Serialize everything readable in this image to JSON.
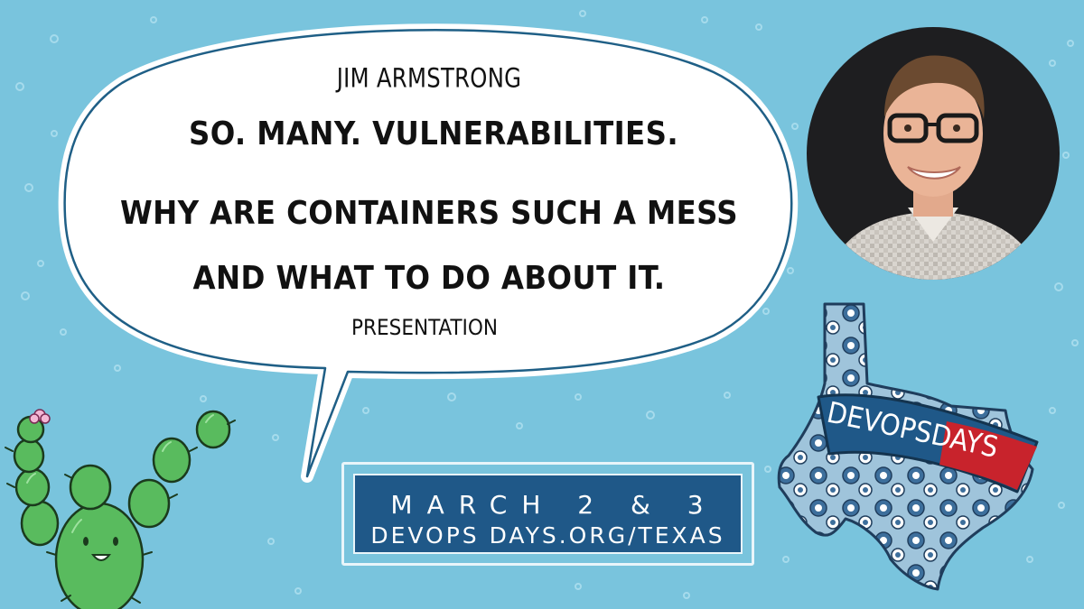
{
  "speaker": "JIM ARMSTRONG",
  "title_line1": "SO. MANY. VULNERABILITIES.",
  "title_line2": "WHY ARE CONTAINERS SUCH A MESS AND WHAT TO DO ABOUT IT.",
  "presentation_type": "PRESENTATION",
  "event": {
    "dates": "MARCH 2 & 3",
    "url": "DEVOPS DAYS.ORG/TEXAS",
    "logo_text": "DEVOPSDAYS"
  },
  "colors": {
    "background": "#79c4dd",
    "navy": "#1f5888",
    "bubble": "#ffffff",
    "bubble_outline": "#1f5f86",
    "cactus": "#59bb5e",
    "texas_red": "#c8232c"
  }
}
